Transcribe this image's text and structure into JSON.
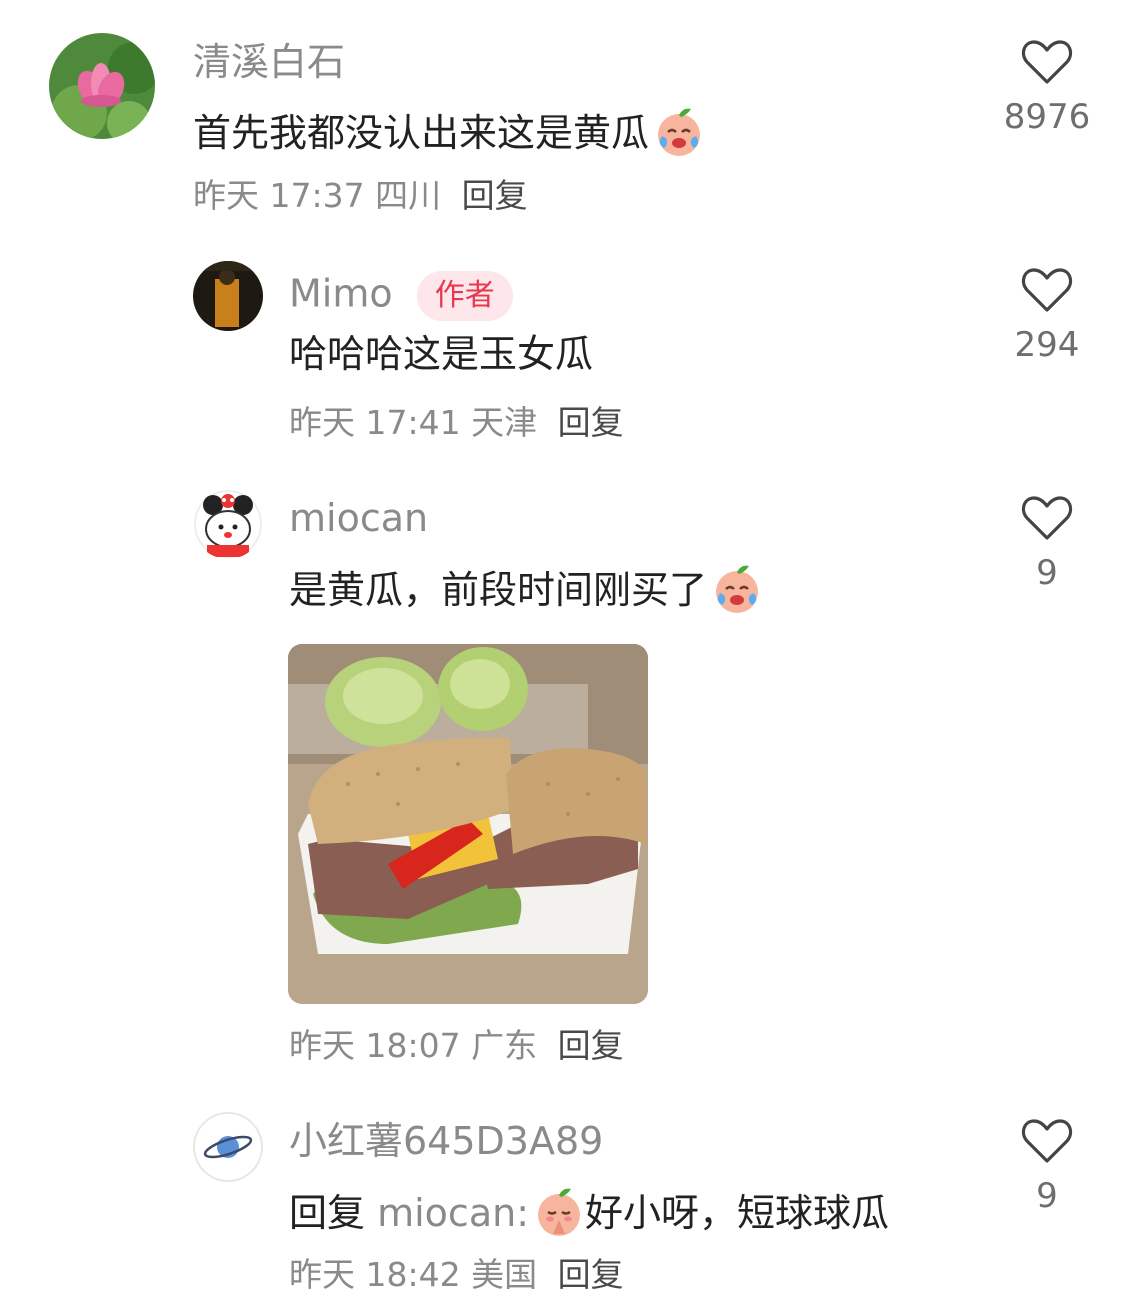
{
  "comments": [
    {
      "user": "清溪白石",
      "text": "首先我都没认出来这是黄瓜",
      "emoji": "crying-laugh-peach-emoji",
      "time": "昨天 17:37",
      "location": "四川",
      "reply_label": "回复",
      "likes": "8976",
      "avatar": "lotus-flower-avatar"
    },
    {
      "user": "Mimo",
      "badge": "作者",
      "text": "哈哈哈这是玉女瓜",
      "time": "昨天 17:41",
      "location": "天津",
      "reply_label": "回复",
      "likes": "294",
      "avatar": "dark-photo-avatar"
    },
    {
      "user": "miocan",
      "text": "是黄瓜，前段时间刚买了",
      "emoji": "crying-laugh-peach-emoji",
      "image": "sandwich-and-melons-photo",
      "time": "昨天 18:07",
      "location": "广东",
      "reply_label": "回复",
      "likes": "9",
      "avatar": "cartoon-bear-avatar"
    },
    {
      "user": "小红薯645D3A89",
      "reply_prefix": "回复",
      "mention": "miocan:",
      "emoji": "praying-peach-emoji",
      "text": "好小呀，短球球瓜",
      "time": "昨天 18:42",
      "location": "美国",
      "reply_label": "回复",
      "likes": "9",
      "avatar": "planet-avatar"
    }
  ],
  "colors": {
    "badge_bg": "#fde7ea",
    "badge_text": "#e8374e",
    "secondary_text": "#8a8a8a",
    "primary_text": "#222222"
  }
}
